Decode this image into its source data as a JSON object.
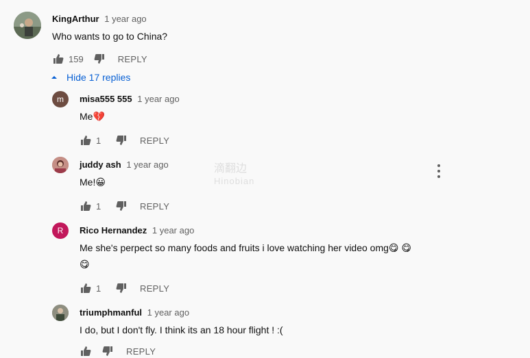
{
  "colors": {
    "link_blue": "#065fd4",
    "muted": "#606060",
    "avatar_m": "#6d4c41",
    "avatar_r": "#c2185b"
  },
  "top_comment": {
    "author": "KingArthur",
    "time": "1 year ago",
    "text": "Who wants to go to China?",
    "likes": "159",
    "reply_label": "REPLY",
    "avatar_icon": "user-photo-avatar"
  },
  "replies_toggle": {
    "label": "Hide 17 replies",
    "icon": "caret-up-icon"
  },
  "replies": [
    {
      "author": "misa555 555",
      "time": "1 year ago",
      "text": "Me",
      "emoji": "💔",
      "likes": "1",
      "reply_label": "REPLY",
      "avatar_letter": "m"
    },
    {
      "author": "juddy ash",
      "time": "1 year ago",
      "text": "Me!",
      "emoji": "😀",
      "likes": "1",
      "reply_label": "REPLY",
      "avatar_icon": "user-photo-avatar"
    },
    {
      "author": "Rico Hernandez",
      "time": "1 year ago",
      "text": "Me she's perpect so many foods and fruits i love watching her video omg",
      "emoji": "😋",
      "emoji2": "😋",
      "emoji3": "😋",
      "likes": "1",
      "reply_label": "REPLY",
      "avatar_letter": "R"
    },
    {
      "author": "triumphmanful",
      "time": "1 year ago",
      "text": "I do, but I don't fly. I think its an 18 hour flight ! :(",
      "reply_label": "REPLY",
      "avatar_icon": "user-photo-avatar"
    }
  ],
  "watermark": {
    "line1": "滴翻边",
    "line2": "Hinobian"
  }
}
